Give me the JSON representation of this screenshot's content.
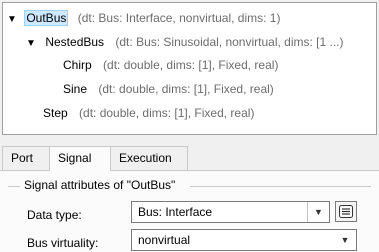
{
  "tree": {
    "nodes": [
      {
        "name": "OutBus",
        "attrs": "(dt: Bus: Interface, nonvirtual, dims: 1)",
        "toggle": "▼",
        "selected": true
      },
      {
        "name": "NestedBus",
        "attrs": "(dt: Bus: Sinusoidal, nonvirtual, dims: [1 ...)",
        "toggle": "▼"
      },
      {
        "name": "Chirp",
        "attrs": "(dt: double, dims: [1], Fixed, real)"
      },
      {
        "name": "Sine",
        "attrs": "(dt: double, dims: [1], Fixed, real)"
      },
      {
        "name": "Step",
        "attrs": "(dt: double, dims: [1], Fixed, real)"
      }
    ]
  },
  "tabs": [
    {
      "label": "Port"
    },
    {
      "label": "Signal",
      "active": true
    },
    {
      "label": "Execution"
    }
  ],
  "signal": {
    "section_title": "Signal attributes of \"OutBus\"",
    "data_type_label": "Data type:",
    "data_type_value": "Bus: Interface",
    "bus_virtuality_label": "Bus virtuality:",
    "bus_virtuality_value": "nonvirtual"
  },
  "colors": {
    "selection_bg": "#cde8ff",
    "selection_border": "#99d1ff",
    "attr_text": "#6d6d6d"
  },
  "icons": {
    "expand": "chevron-down-icon",
    "edit": "table-edit-icon"
  }
}
